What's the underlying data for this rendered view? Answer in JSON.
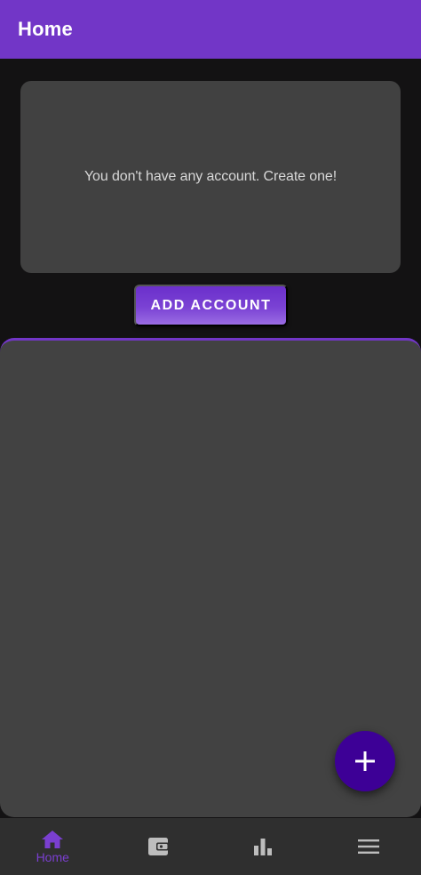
{
  "app_bar": {
    "title": "Home"
  },
  "accounts": {
    "empty_message": "You don't have any account. Create one!",
    "add_button_label": "ADD ACCOUNT"
  },
  "fab": {
    "icon": "plus-icon"
  },
  "bottom_nav": {
    "items": [
      {
        "icon": "home-icon",
        "label": "Home",
        "active": true
      },
      {
        "icon": "wallet-icon",
        "label": "",
        "active": false
      },
      {
        "icon": "bar-chart-icon",
        "label": "",
        "active": false
      },
      {
        "icon": "menu-icon",
        "label": "",
        "active": false
      }
    ]
  },
  "colors": {
    "primary": "#7236c7",
    "fab": "#3d0096",
    "background": "#131213",
    "surface": "#424242",
    "nav_background": "#2f2f2f",
    "nav_inactive": "#bdbdbd"
  }
}
